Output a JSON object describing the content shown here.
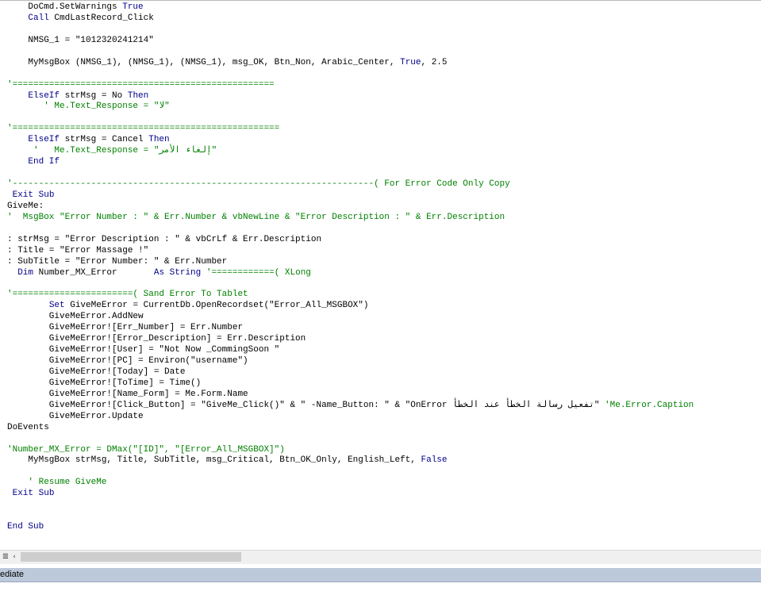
{
  "code_lines": [
    [
      {
        "t": "    DoCmd.SetWarnings ",
        "c": "n"
      },
      {
        "t": "True",
        "c": "k"
      }
    ],
    [
      {
        "t": "    ",
        "c": "n"
      },
      {
        "t": "Call",
        "c": "k"
      },
      {
        "t": " CmdLastRecord_Click",
        "c": "n"
      }
    ],
    [
      {
        "t": "",
        "c": "n"
      }
    ],
    [
      {
        "t": "    NMSG_1 = \"1012320241214\"",
        "c": "n"
      }
    ],
    [
      {
        "t": "",
        "c": "n"
      }
    ],
    [
      {
        "t": "    MyMsgBox (NMSG_1), (NMSG_1), (NMSG_1), msg_OK, Btn_Non, Arabic_Center, ",
        "c": "n"
      },
      {
        "t": "True",
        "c": "k"
      },
      {
        "t": ", 2.5",
        "c": "n"
      }
    ],
    [
      {
        "t": "",
        "c": "n"
      }
    ],
    [
      {
        "t": "'==================================================",
        "c": "m"
      }
    ],
    [
      {
        "t": "    ",
        "c": "n"
      },
      {
        "t": "ElseIf",
        "c": "k"
      },
      {
        "t": " strMsg = No ",
        "c": "n"
      },
      {
        "t": "Then",
        "c": "k"
      }
    ],
    [
      {
        "t": "       ' Me.Text_Response = \"لا\"",
        "c": "m"
      }
    ],
    [
      {
        "t": "",
        "c": "n"
      }
    ],
    [
      {
        "t": "'===================================================",
        "c": "m"
      }
    ],
    [
      {
        "t": "    ",
        "c": "n"
      },
      {
        "t": "ElseIf",
        "c": "k"
      },
      {
        "t": " strMsg = Cancel ",
        "c": "n"
      },
      {
        "t": "Then",
        "c": "k"
      }
    ],
    [
      {
        "t": "     '   Me.Text_Response = \"إلغاء الأمر\"",
        "c": "m"
      }
    ],
    [
      {
        "t": "    ",
        "c": "n"
      },
      {
        "t": "End If",
        "c": "k"
      }
    ],
    [
      {
        "t": "",
        "c": "n"
      }
    ],
    [
      {
        "t": "'---------------------------------------------------------------------( For Error Code Only Copy",
        "c": "m"
      }
    ],
    [
      {
        "t": " ",
        "c": "n"
      },
      {
        "t": "Exit Sub",
        "c": "k"
      }
    ],
    [
      {
        "t": "GiveMe:",
        "c": "n"
      }
    ],
    [
      {
        "t": "'  MsgBox \"Error Number : \" & Err.Number & vbNewLine & \"Error Description : \" & Err.Description",
        "c": "m"
      }
    ],
    [
      {
        "t": "",
        "c": "n"
      }
    ],
    [
      {
        "t": ": strMsg = \"Error Description : \" & vbCrLf & Err.Description",
        "c": "n"
      }
    ],
    [
      {
        "t": ": Title = \"Error Massage !\"",
        "c": "n"
      }
    ],
    [
      {
        "t": ": SubTitle = \"Error Number: \" & Err.Number",
        "c": "n"
      }
    ],
    [
      {
        "t": "  ",
        "c": "n"
      },
      {
        "t": "Dim",
        "c": "k"
      },
      {
        "t": " Number_MX_Error       ",
        "c": "n"
      },
      {
        "t": "As String",
        "c": "k"
      },
      {
        "t": " ",
        "c": "n"
      },
      {
        "t": "'============( XLong",
        "c": "m"
      }
    ],
    [
      {
        "t": "",
        "c": "n"
      }
    ],
    [
      {
        "t": "'=======================( Sand Error To Tablet",
        "c": "m"
      }
    ],
    [
      {
        "t": "        ",
        "c": "n"
      },
      {
        "t": "Set",
        "c": "k"
      },
      {
        "t": " GiveMeError = CurrentDb.OpenRecordset(\"Error_All_MSGBOX\")",
        "c": "n"
      }
    ],
    [
      {
        "t": "        GiveMeError.AddNew",
        "c": "n"
      }
    ],
    [
      {
        "t": "        GiveMeError![Err_Number] = Err.Number",
        "c": "n"
      }
    ],
    [
      {
        "t": "        GiveMeError![Error_Description] = Err.Description",
        "c": "n"
      }
    ],
    [
      {
        "t": "        GiveMeError![User] = \"Not Now _CommingSoon \"",
        "c": "n"
      }
    ],
    [
      {
        "t": "        GiveMeError![PC] = Environ(\"username\")",
        "c": "n"
      }
    ],
    [
      {
        "t": "        GiveMeError![Today] = Date",
        "c": "n"
      }
    ],
    [
      {
        "t": "        GiveMeError![ToTime] = Time()",
        "c": "n"
      }
    ],
    [
      {
        "t": "        GiveMeError![Name_Form] = Me.Form.Name",
        "c": "n"
      }
    ],
    [
      {
        "t": "        GiveMeError![Click_Button] = \"GiveMe_Click()\" & \" -Name_Button: \" & \"OnError تفعيل رسالة الخطأ عند الخطأ\" ",
        "c": "n"
      },
      {
        "t": "'Me.Error.Caption",
        "c": "m"
      }
    ],
    [
      {
        "t": "        GiveMeError.Update",
        "c": "n"
      }
    ],
    [
      {
        "t": "DoEvents",
        "c": "n"
      }
    ],
    [
      {
        "t": "",
        "c": "n"
      }
    ],
    [
      {
        "t": "'Number_MX_Error = DMax(\"[ID]\", \"[Error_All_MSGBOX]\")",
        "c": "m"
      }
    ],
    [
      {
        "t": "    MyMsgBox strMsg, Title, SubTitle, msg_Critical, Btn_OK_Only, English_Left, ",
        "c": "n"
      },
      {
        "t": "False",
        "c": "k"
      }
    ],
    [
      {
        "t": "",
        "c": "n"
      }
    ],
    [
      {
        "t": "    ' Resume GiveMe",
        "c": "m"
      }
    ],
    [
      {
        "t": " ",
        "c": "n"
      },
      {
        "t": "Exit Sub",
        "c": "k"
      }
    ],
    [
      {
        "t": "",
        "c": "n"
      }
    ],
    [
      {
        "t": "",
        "c": "n"
      }
    ],
    [
      {
        "t": "End Sub",
        "c": "k"
      }
    ]
  ],
  "scrollbar": {
    "procedure_view_icon": "≣",
    "left_arrow_icon": "‹"
  },
  "immediate_panel": {
    "title": "ediate"
  }
}
